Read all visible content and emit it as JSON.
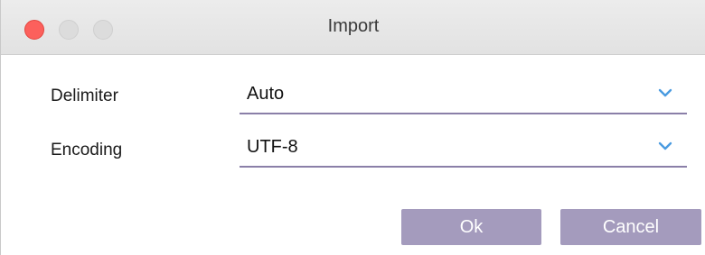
{
  "window": {
    "title": "Import"
  },
  "form": {
    "delimiter": {
      "label": "Delimiter",
      "value": "Auto"
    },
    "encoding": {
      "label": "Encoding",
      "value": "UTF-8"
    }
  },
  "buttons": {
    "ok_label": "Ok",
    "cancel_label": "Cancel"
  },
  "icons": {
    "dropdown": "chevron-down-icon"
  },
  "colors": {
    "accent": "#a49bbd",
    "underline": "#8a7fa8",
    "chevron": "#4a9be0",
    "close": "#fc605c"
  }
}
